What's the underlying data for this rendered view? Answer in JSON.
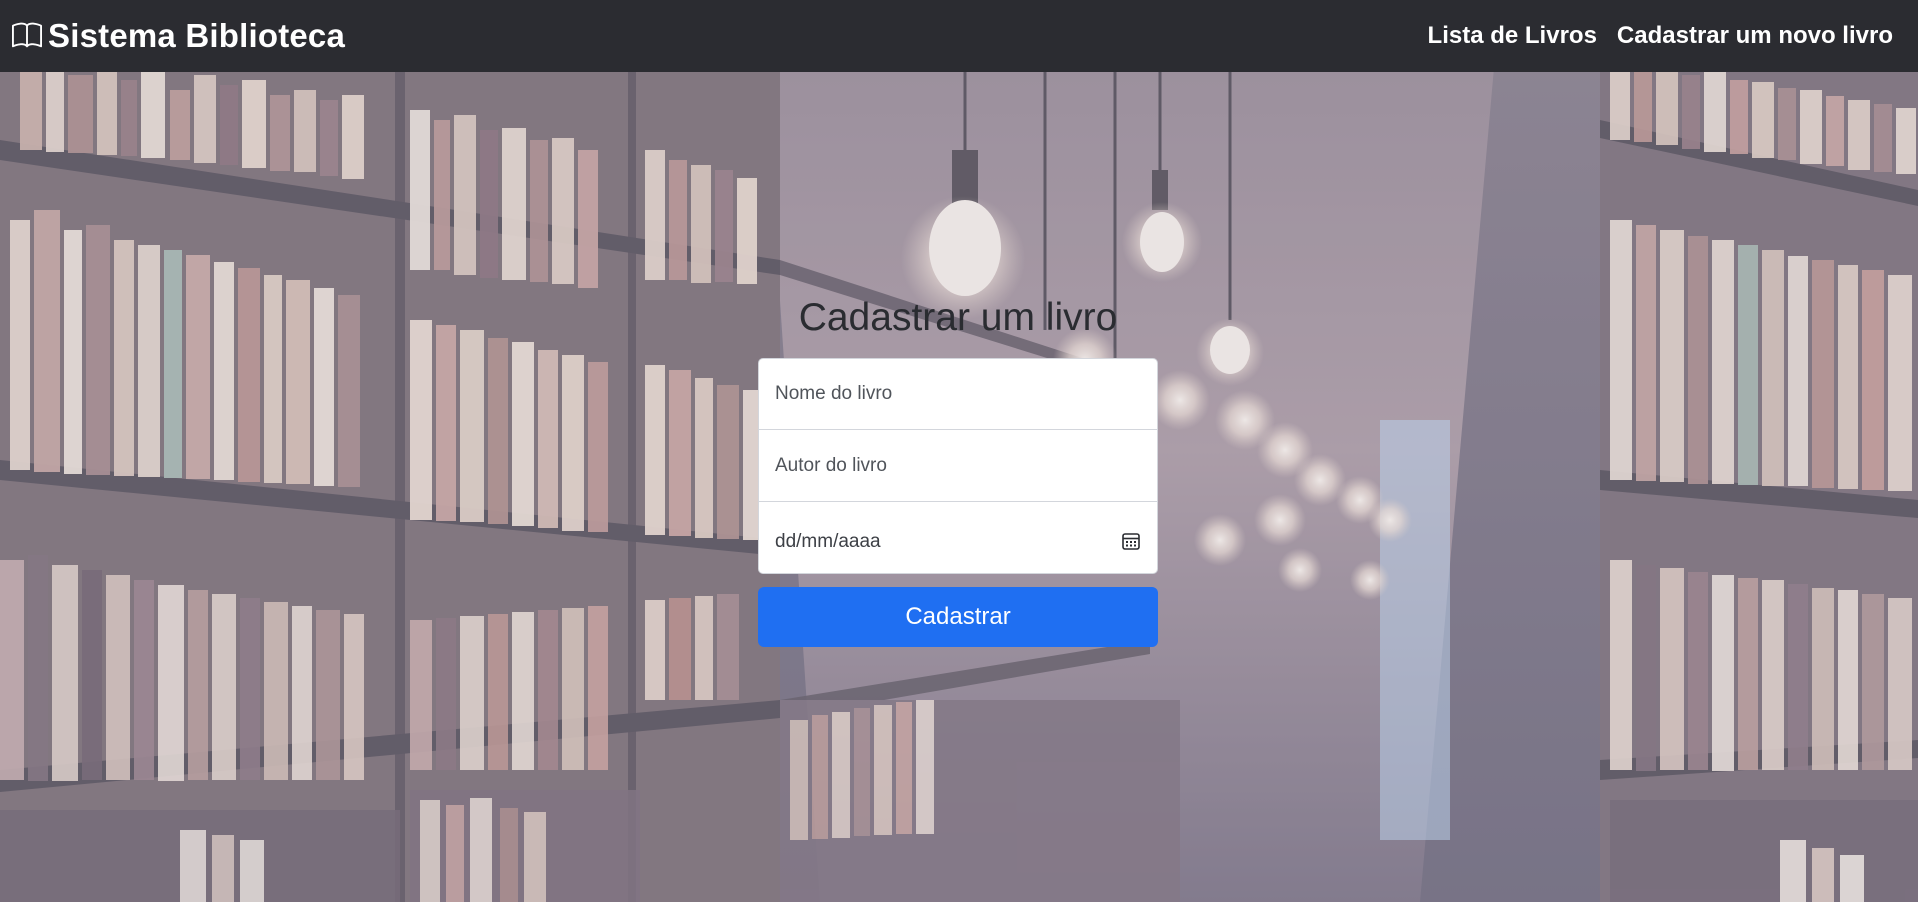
{
  "navbar": {
    "brand_icon": "book-icon",
    "brand_text": "Sistema Biblioteca",
    "links": [
      {
        "label": "Lista de Livros"
      },
      {
        "label": "Cadastrar um novo livro"
      }
    ],
    "background_color": "#2b2c31"
  },
  "form": {
    "title": "Cadastrar um livro",
    "name_placeholder": "Nome do livro",
    "author_placeholder": "Autor do livro",
    "date_placeholder": "dd/mm/aaaa",
    "date_icon": "calendar-icon",
    "submit_label": "Cadastrar",
    "submit_color": "#1f6ff2"
  },
  "background": {
    "description_icon": "library-background-image"
  }
}
